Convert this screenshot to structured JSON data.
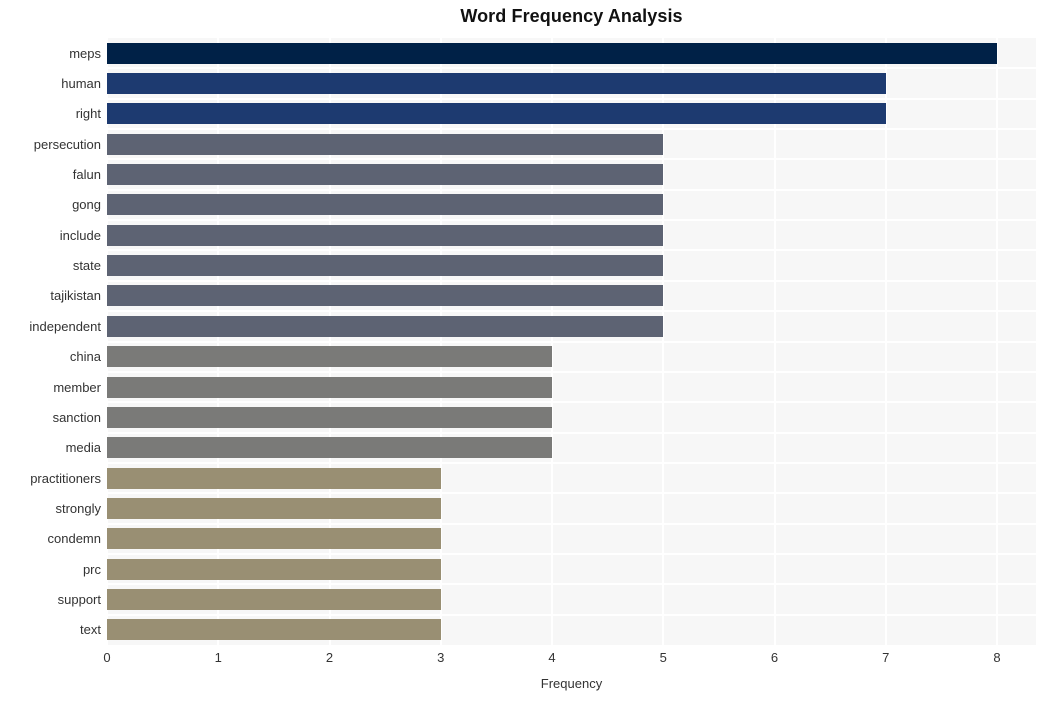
{
  "chart_data": {
    "type": "bar",
    "orientation": "horizontal",
    "title": "Word Frequency Analysis",
    "xlabel": "Frequency",
    "ylabel": "",
    "xlim": [
      0,
      8.35
    ],
    "xticks": [
      0,
      1,
      2,
      3,
      4,
      5,
      6,
      7,
      8
    ],
    "xticklabels": [
      "0",
      "1",
      "2",
      "3",
      "4",
      "5",
      "6",
      "7",
      "8"
    ],
    "grid": true,
    "grid_color": "#ffffff",
    "plot_background": "#f7f7f7",
    "figure_background": "#ffffff",
    "legend": null,
    "categories": [
      "meps",
      "human",
      "right",
      "persecution",
      "falun",
      "gong",
      "include",
      "state",
      "tajikistan",
      "independent",
      "china",
      "member",
      "sanction",
      "media",
      "practitioners",
      "strongly",
      "condemn",
      "prc",
      "support",
      "text"
    ],
    "values": [
      8,
      7,
      7,
      5,
      5,
      5,
      5,
      5,
      5,
      5,
      4,
      4,
      4,
      4,
      3,
      3,
      3,
      3,
      3,
      3
    ],
    "bar_colors": [
      "#002147",
      "#1d3a70",
      "#1d3a70",
      "#5d6373",
      "#5d6373",
      "#5d6373",
      "#5d6373",
      "#5d6373",
      "#5d6373",
      "#5d6373",
      "#7a7a78",
      "#7a7a78",
      "#7a7a78",
      "#7a7a78",
      "#998f73",
      "#998f73",
      "#998f73",
      "#998f73",
      "#998f73",
      "#998f73"
    ]
  }
}
